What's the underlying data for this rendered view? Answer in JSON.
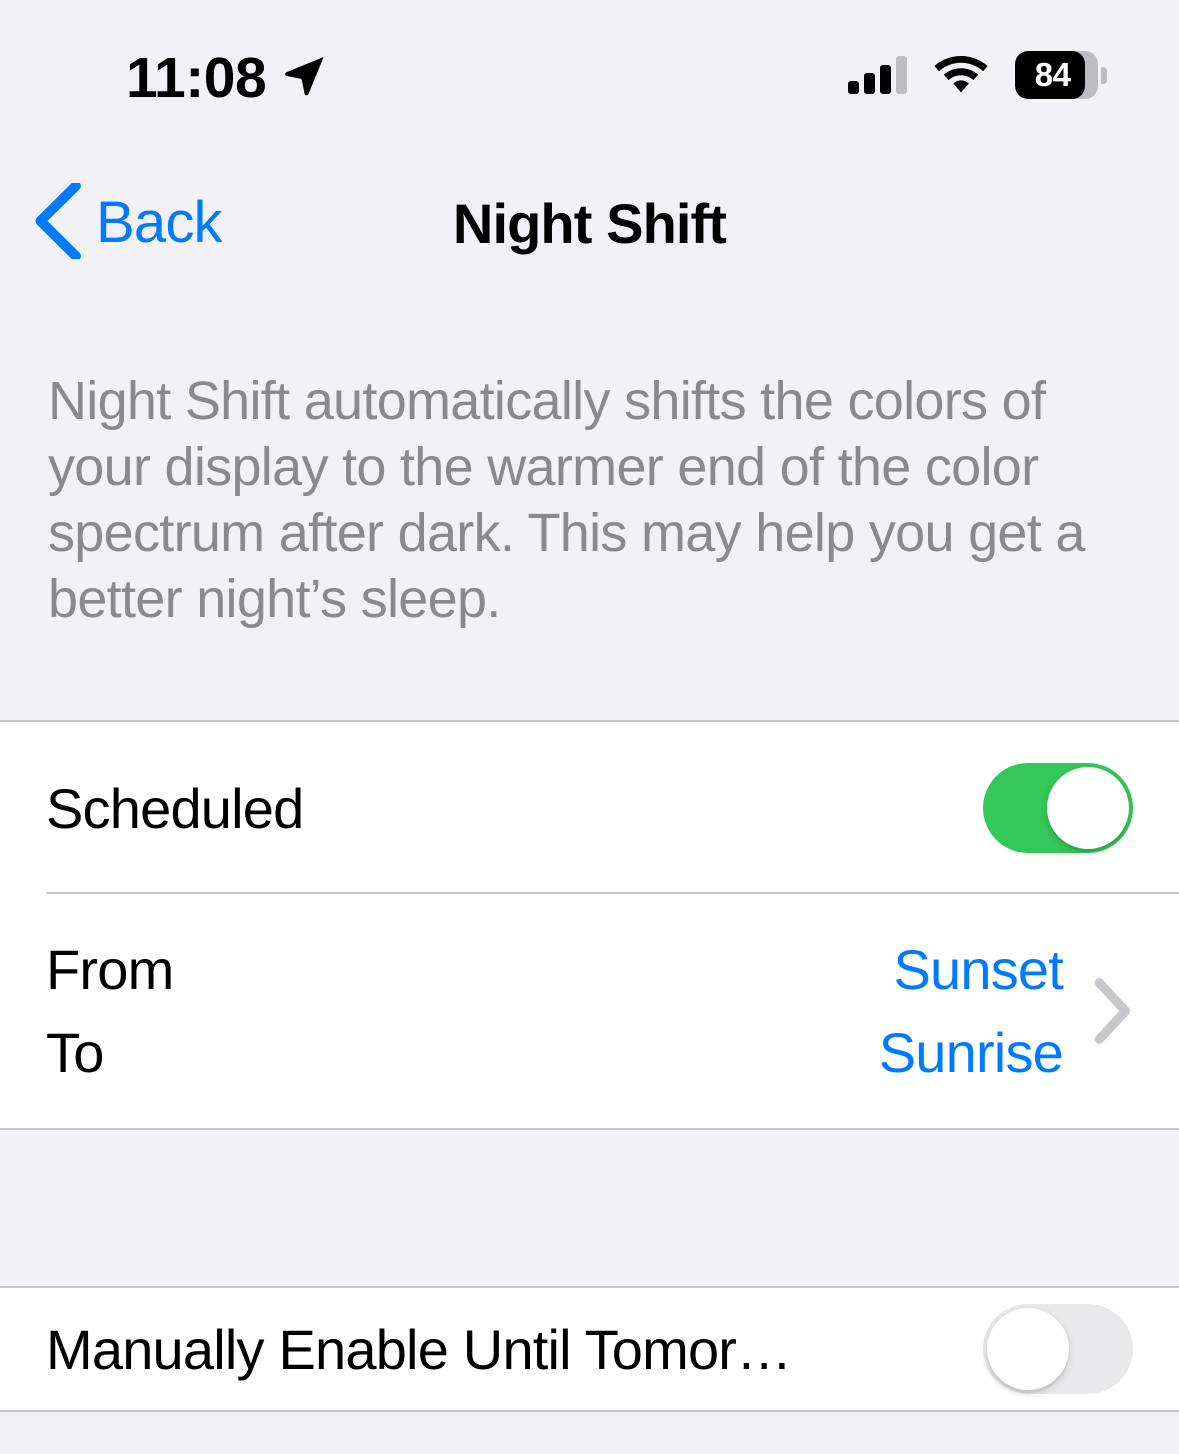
{
  "status_bar": {
    "time": "11:08",
    "location_icon": "location-arrow-icon",
    "signal_icon": "cellular-signal-icon",
    "wifi_icon": "wifi-icon",
    "battery_icon": "battery-icon",
    "battery_percent": "84"
  },
  "nav": {
    "back_label": "Back",
    "back_icon": "chevron-left-icon",
    "title": "Night Shift"
  },
  "description": "Night Shift automatically shifts the colors of your display to the warmer end of the color spectrum after dark. This may help you get a better night’s sleep.",
  "schedule_group": {
    "scheduled": {
      "label": "Scheduled",
      "toggle_state": "on"
    },
    "from": {
      "label": "From",
      "value": "Sunset"
    },
    "to": {
      "label": "To",
      "value": "Sunrise"
    },
    "disclosure_icon": "chevron-right-icon"
  },
  "manual_group": {
    "manual_enable": {
      "label": "Manually Enable Until Tomor…",
      "toggle_state": "off"
    }
  },
  "colors": {
    "accent_blue": "#007AFF",
    "toggle_on_green": "#34C759",
    "toggle_off_gray": "#E9E9EB",
    "background_gray": "#F2F1F6",
    "cell_white": "#FFFFFF",
    "separator": "#C6C6C8",
    "secondary_text": "#8A8A8E",
    "chevron_gray": "#C7C7CC"
  }
}
